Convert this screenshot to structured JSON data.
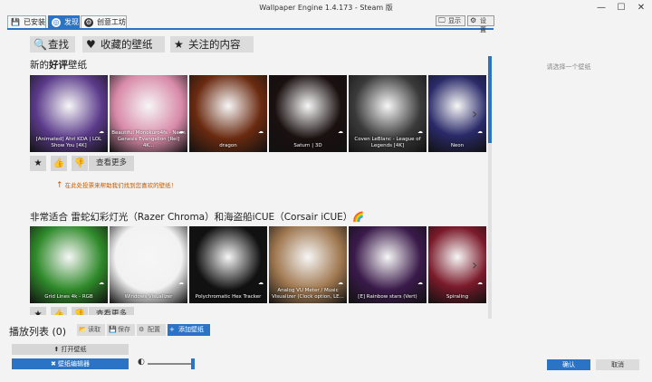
{
  "window": {
    "title": "Wallpaper Engine 1.4.173 - Steam 版"
  },
  "tabs": [
    {
      "label": "已安装",
      "icon": "save-icon"
    },
    {
      "label": "发现",
      "icon": "compass-icon"
    },
    {
      "label": "创意工坊",
      "icon": "steam-icon"
    }
  ],
  "toolbar": {
    "display_label": "显示",
    "settings_label": "设置"
  },
  "discover": {
    "search_label": "查找",
    "favorites_label": "收藏的壁纸",
    "following_label": "关注的内容"
  },
  "section1": {
    "title_part1": "新的",
    "title_part2": "好评",
    "title_part3": "壁纸",
    "cards": [
      {
        "caption": "[Animated] Ahri KDA | LOL\nShow You [4K]",
        "color": "#5a3a8a"
      },
      {
        "caption": "Beautiful Monokuro4fs - Neon\nGenesis Evangelion [Rei] 4K...",
        "color": "#d88aa8"
      },
      {
        "caption": "dragon",
        "color": "#6a2a10"
      },
      {
        "caption": "Saturn | 3D",
        "color": "#1a1010"
      },
      {
        "caption": "Coven LeBlanc - League of\nLegends [4K]",
        "color": "#3a3a3a"
      },
      {
        "caption": "Neon",
        "color": "#2a2a6a"
      }
    ],
    "more_label": "查看更多",
    "hint": "在此处投票来帮助我们找到您喜欢的壁纸！"
  },
  "section2": {
    "title": "非常适合 雷蛇幻彩灯光（Razer Chroma）和海盗船iCUE（Corsair iCUE）🌈",
    "cards": [
      {
        "caption": "Grid Lines 4k - RGB",
        "color": "#2f8a2a"
      },
      {
        "caption": "Windows Visualizer",
        "color": "#f2f2f2"
      },
      {
        "caption": "Polychromatic Hex Tracker",
        "color": "#111111"
      },
      {
        "caption": "Analog VU Meter / Music\nVisualizer (Clock option, LE...",
        "color": "#a07850"
      },
      {
        "caption": "[E] Rainbow stars (Vert)",
        "color": "#3a1a4a"
      },
      {
        "caption": "Spiraling",
        "color": "#7a1a2a"
      }
    ],
    "more_label": "查看更多"
  },
  "preview": {
    "placeholder": "请选择一个壁纸"
  },
  "playlist": {
    "title": "播放列表",
    "count": "(0)",
    "load_label": "读取",
    "save_label": "保存",
    "config_label": "配置",
    "add_label": "添加壁纸"
  },
  "bottom": {
    "open_label": "打开壁纸",
    "editor_label": "壁纸编辑器",
    "ok_label": "确认",
    "cancel_label": "取消"
  },
  "colors": {
    "accent": "#2b73c5",
    "hint": "#c25a00"
  }
}
